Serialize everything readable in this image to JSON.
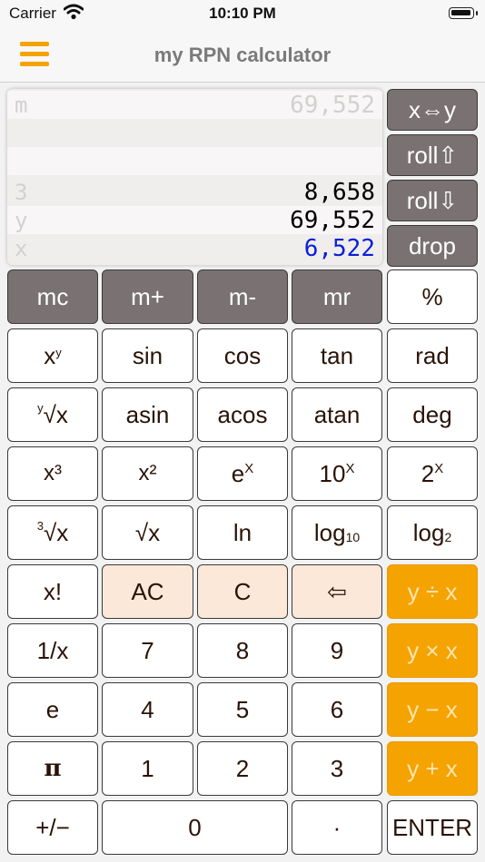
{
  "status": {
    "carrier": "Carrier",
    "time": "10:10 PM"
  },
  "nav": {
    "title": "my RPN calculator",
    "menu_icon": "hamburger-menu-icon"
  },
  "stack": {
    "memory": {
      "label": "m",
      "value": "69,552"
    },
    "reg3": {
      "label": "3",
      "value": "8,658"
    },
    "y": {
      "label": "y",
      "value": "69,552"
    },
    "x": {
      "label": "x",
      "value": "6,522"
    }
  },
  "stack_buttons": [
    "x⇔y",
    "roll⇧",
    "roll⇩",
    "drop"
  ],
  "keys": {
    "mc": "mc",
    "mplus": "m+",
    "mminus": "m-",
    "mr": "mr",
    "percent": "%",
    "sin": "sin",
    "cos": "cos",
    "tan": "tan",
    "rad": "rad",
    "asin": "asin",
    "acos": "acos",
    "atan": "atan",
    "deg": "deg",
    "ln": "ln",
    "fact": "x!",
    "ac": "AC",
    "c": "C",
    "backspace": "⇦",
    "divide": "y ÷ x",
    "recip": "1/x",
    "d7": "7",
    "d8": "8",
    "d9": "9",
    "multiply": "y × x",
    "e": "e",
    "d4": "4",
    "d5": "5",
    "d6": "6",
    "subtract": "y − x",
    "pi": "π",
    "d1": "1",
    "d2": "2",
    "d3": "3",
    "add": "y + x",
    "sign": "+/−",
    "d0": "0",
    "dot": "·",
    "enter": "ENTER"
  },
  "colors": {
    "accent": "#f5a300",
    "x_register": "#0a1fd8",
    "memory_key": "#7a7272",
    "clear_key": "#fbe8d8"
  }
}
